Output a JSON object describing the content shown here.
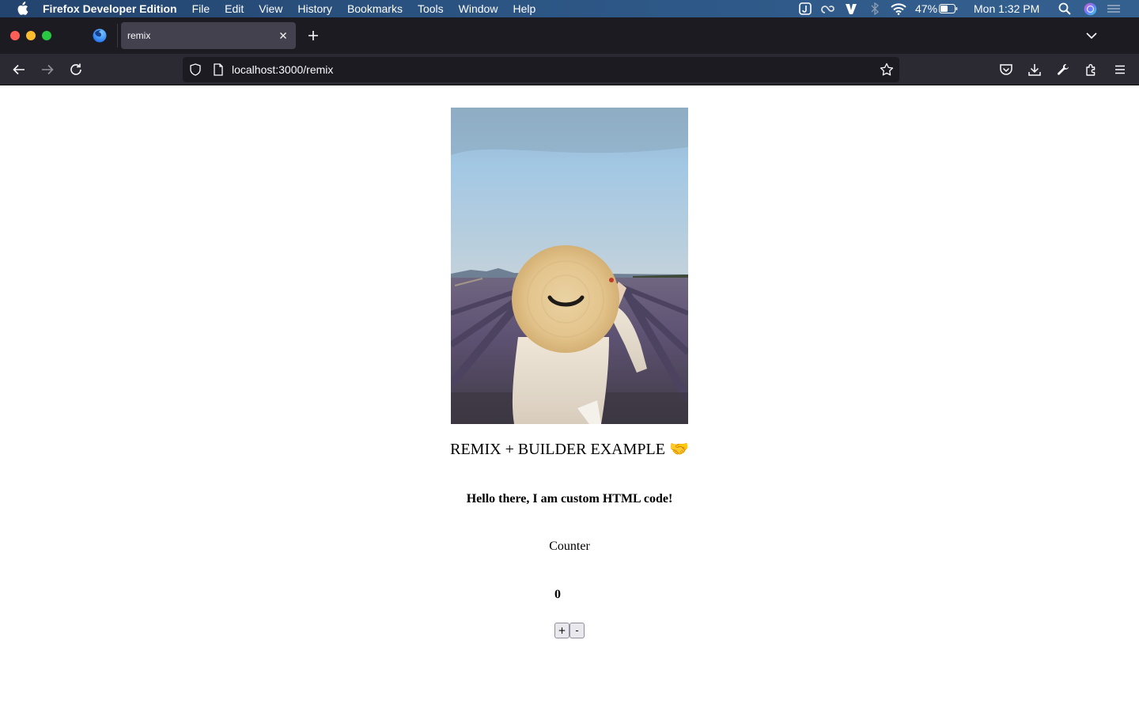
{
  "menubar": {
    "app_name": "Firefox Developer Edition",
    "menus": [
      "File",
      "Edit",
      "View",
      "History",
      "Bookmarks",
      "Tools",
      "Window",
      "Help"
    ],
    "battery": "47%",
    "clock": "Mon 1:32 PM"
  },
  "tabs": {
    "active_title": "remix"
  },
  "navbar": {
    "url": "localhost:3000/remix"
  },
  "page": {
    "heading": "REMIX + BUILDER EXAMPLE 🤝",
    "custom_html": "Hello there, I am custom HTML code!",
    "counter_label": "Counter",
    "counter_value": "0",
    "increment_label": "+",
    "decrement_label": "-"
  },
  "colors": {
    "menubar": "#2c5584",
    "tabstrip": "#1c1b22",
    "active_tab": "#42414d",
    "navbar": "#2b2a33",
    "urlbar": "#1c1b22"
  }
}
